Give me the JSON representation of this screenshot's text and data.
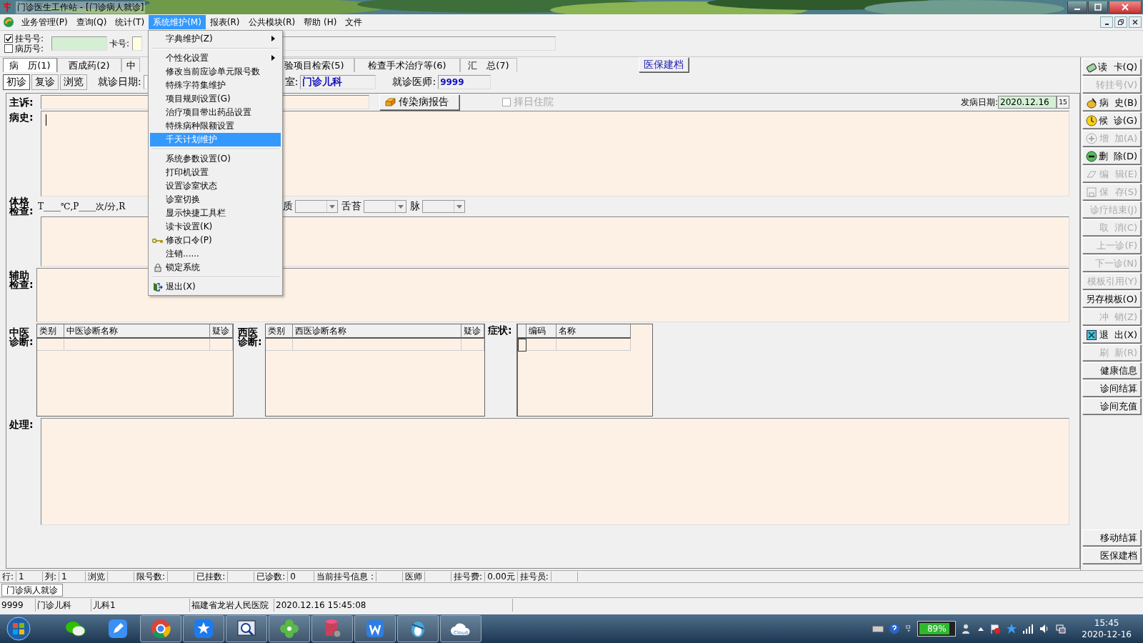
{
  "window": {
    "title": "门诊医生工作站 - [门诊病人就诊]"
  },
  "menu_bar": [
    {
      "label": "业务管理(P)",
      "selected": false
    },
    {
      "label": "查询(Q)",
      "selected": false
    },
    {
      "label": "统计(T)",
      "selected": false
    },
    {
      "label": "系统维护(M)",
      "selected": true
    },
    {
      "label": "报表(R)",
      "selected": false
    },
    {
      "label": "公共模块(R)",
      "selected": false
    },
    {
      "label": "帮助 (H)",
      "selected": false
    },
    {
      "label": "文件",
      "selected": false
    }
  ],
  "open_menu": [
    {
      "kind": "item",
      "label": "字典维护(Z)",
      "submenu": true,
      "selected": false
    },
    {
      "kind": "separator"
    },
    {
      "kind": "item",
      "label": "个性化设置",
      "submenu": true,
      "selected": false
    },
    {
      "kind": "item",
      "label": "修改当前应诊单元限号数",
      "submenu": false,
      "selected": false
    },
    {
      "kind": "item",
      "label": "特殊字符集维护",
      "submenu": false,
      "selected": false
    },
    {
      "kind": "item",
      "label": "项目规则设置(G)",
      "submenu": false,
      "selected": false
    },
    {
      "kind": "item",
      "label": "治疗项目带出药品设置",
      "submenu": false,
      "selected": false
    },
    {
      "kind": "item",
      "label": "特殊病种限额设置",
      "submenu": false,
      "selected": false
    },
    {
      "kind": "item",
      "label": "千天计划维护",
      "submenu": false,
      "selected": true
    },
    {
      "kind": "separator"
    },
    {
      "kind": "item",
      "label": "系统参数设置(O)",
      "submenu": false,
      "selected": false
    },
    {
      "kind": "item",
      "label": "打印机设置",
      "submenu": false,
      "selected": false
    },
    {
      "kind": "item",
      "label": "设置诊室状态",
      "submenu": false,
      "selected": false
    },
    {
      "kind": "item",
      "label": "诊室切换",
      "submenu": false,
      "selected": false
    },
    {
      "kind": "item",
      "label": "显示快捷工具栏",
      "submenu": false,
      "selected": false
    },
    {
      "kind": "item",
      "label": "读卡设置(K)",
      "submenu": false,
      "selected": false
    },
    {
      "kind": "item",
      "label": "修改口令(P)",
      "submenu": false,
      "selected": false
    },
    {
      "kind": "item",
      "label": "注销......",
      "submenu": false,
      "selected": false
    },
    {
      "kind": "item",
      "label": "锁定系统",
      "submenu": false,
      "selected": false
    },
    {
      "kind": "separator"
    },
    {
      "kind": "item",
      "label": "退出(X)",
      "submenu": false,
      "selected": false
    }
  ],
  "lookup": {
    "checks": [
      {
        "label": "挂号号:",
        "checked": true
      },
      {
        "label": "病历号:",
        "checked": false
      }
    ],
    "card_label": "卡号:"
  },
  "tabs": [
    {
      "label": "病　历(1)",
      "selected": true
    },
    {
      "label": "西成药(2)",
      "selected": false
    },
    {
      "label": "中",
      "selected": false
    },
    {
      "label": "验项目检索(5)",
      "selected": false
    },
    {
      "label": "检查手术治疗等(6)",
      "selected": false
    },
    {
      "label": "汇　总(7)",
      "selected": false
    }
  ],
  "insurance_button": "医保建档",
  "visit_tabs": [
    {
      "label": "初诊",
      "selected": true
    },
    {
      "label": "复诊",
      "selected": false
    },
    {
      "label": "浏览",
      "selected": false
    }
  ],
  "visit_date_label": "就诊日期:",
  "dept": {
    "label": "室:",
    "value": "门诊儿科"
  },
  "doctor": {
    "label": "就诊医师:",
    "value": "9999"
  },
  "complaint_label": "主诉:",
  "report_button": "传染病报告",
  "hospitalize": {
    "label": "择日住院",
    "checked": false,
    "disabled": true
  },
  "onset": {
    "label": "发病日期:",
    "value": "2020.12.16",
    "calendar": "15"
  },
  "history_label": "病史:",
  "exam": {
    "label": "体格检查:",
    "vitals": "T____℃,P____次/分,R",
    "tongue_label": "质",
    "coating_label": "舌苔",
    "pulse_label": "脉"
  },
  "aux_label": "辅助检查:",
  "tcm": {
    "label": "中医诊断:",
    "columns": [
      "类别",
      "中医诊断名称",
      "疑诊"
    ]
  },
  "western": {
    "label": "西医诊断:",
    "columns": [
      "类别",
      "西医诊断名称",
      "疑诊"
    ]
  },
  "symptoms": {
    "label": "症状:",
    "columns": [
      "编码",
      "名称"
    ]
  },
  "treatment_label": "处理:",
  "side_buttons": [
    {
      "label": "读  卡(Q)",
      "disabled": false
    },
    {
      "label": "转挂号(V)",
      "disabled": true
    },
    {
      "label": "病  史(B)",
      "disabled": false
    },
    {
      "label": "候  诊(G)",
      "disabled": false
    },
    {
      "label": "增  加(A)",
      "disabled": true
    },
    {
      "label": "删  除(D)",
      "disabled": false
    },
    {
      "label": "编  辑(E)",
      "disabled": true
    },
    {
      "label": "保  存(S)",
      "disabled": true
    },
    {
      "label": "诊疗结束(J)",
      "disabled": true
    },
    {
      "label": "取  消(C)",
      "disabled": true
    },
    {
      "label": "上一诊(F)",
      "disabled": true
    },
    {
      "label": "下一诊(N)",
      "disabled": true
    },
    {
      "label": "模板引用(Y)",
      "disabled": true
    },
    {
      "label": "另存模板(O)",
      "disabled": false
    },
    {
      "label": "冲  销(Z)",
      "disabled": true
    },
    {
      "label": "退  出(X)",
      "disabled": false
    },
    {
      "label": "刷  新(R)",
      "disabled": true
    },
    {
      "label": "健康信息",
      "disabled": false
    },
    {
      "label": "诊间结算",
      "disabled": false
    },
    {
      "label": "诊间充值",
      "disabled": false
    }
  ],
  "side_buttons_bottom": [
    {
      "label": "移动结算",
      "disabled": false
    },
    {
      "label": "医保建档",
      "disabled": false
    }
  ],
  "status_bar": [
    {
      "label": "行:",
      "value": "1"
    },
    {
      "label": "列:",
      "value": "1"
    },
    {
      "label": "浏览"
    },
    {
      "label": "限号数:"
    },
    {
      "label": "已挂数:"
    },
    {
      "label": "已诊数:",
      "value": "0"
    },
    {
      "label": "当前挂号信息 :"
    },
    {
      "label": "医师"
    },
    {
      "label": "挂号费:",
      "value": "0.00元"
    },
    {
      "label": "挂号员:"
    }
  ],
  "task_tab": "门诊病人就诊",
  "info_bar": [
    "9999",
    "门诊儿科",
    "儿科1",
    "福建省龙岩人民医院",
    "2020.12.16 15:45:08"
  ],
  "taskbar": {
    "apps": [
      {
        "kind": "chat"
      },
      {
        "kind": "pen"
      },
      {
        "kind": "browser"
      },
      {
        "kind": "star"
      },
      {
        "kind": "magnifier"
      },
      {
        "kind": "clover"
      },
      {
        "kind": "database"
      },
      {
        "kind": "writer"
      },
      {
        "kind": "penguin"
      },
      {
        "kind": "cloud",
        "label": "Cloud"
      }
    ],
    "battery": "89%",
    "time": "15:45",
    "date": "2020-12-16"
  }
}
